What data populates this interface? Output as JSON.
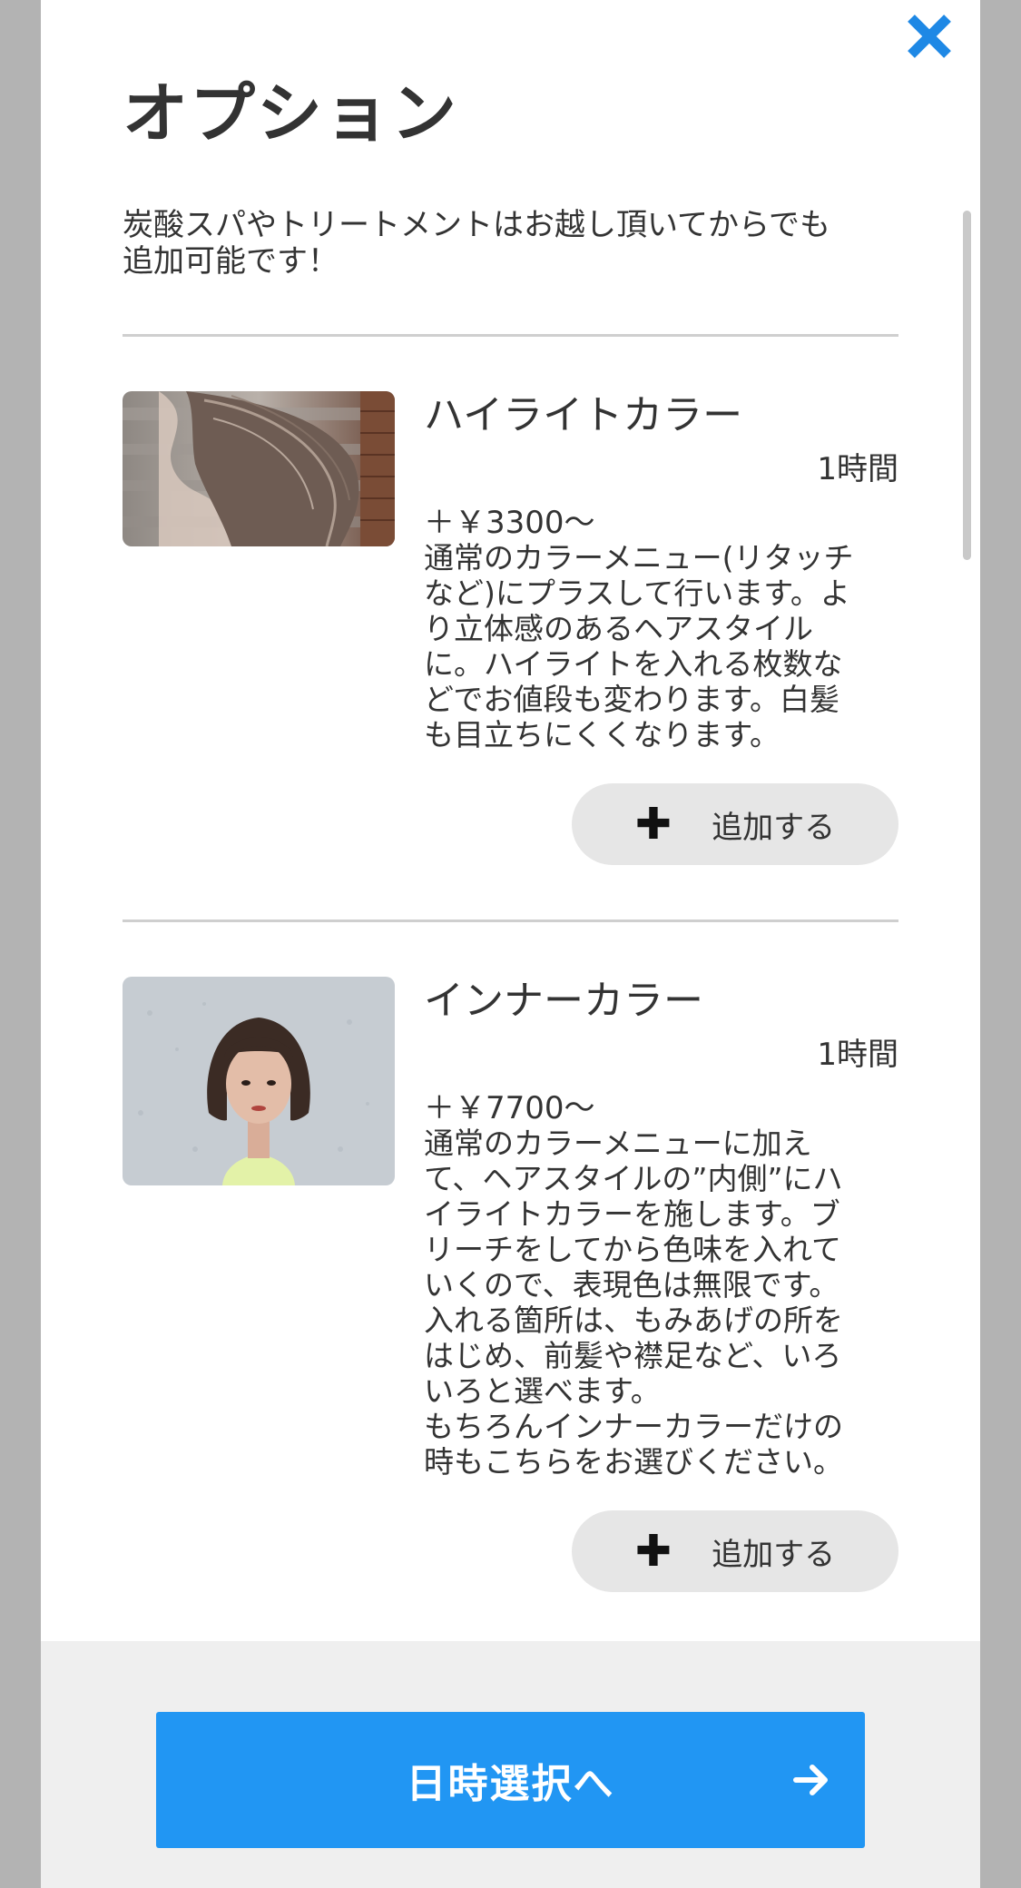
{
  "modal": {
    "title": "オプション",
    "intro": "炭酸スパやトリートメントはお越し頂いてからでも\n追加可能です！",
    "close_icon": "close-icon"
  },
  "options": [
    {
      "name": "ハイライトカラー",
      "duration": "1時間",
      "price": "＋￥3300〜",
      "description": "通常のカラーメニュー(リタッチ\nなど)にプラスして行います。よ\nり立体感のあるヘアスタイル\nに。ハイライトを入れる枚数な\nどでお値段も変わります。白髪\nも目立ちにくくなります。",
      "add_label": "追加する",
      "image": "hair-highlight-photo"
    },
    {
      "name": "インナーカラー",
      "duration": "1時間",
      "price": "＋￥7700〜",
      "description": "通常のカラーメニューに加え\nて、ヘアスタイルの”内側”にハ\nイライトカラーを施します。ブ\nリーチをしてから色味を入れて\nいくので、表現色は無限です。\n入れる箇所は、もみあげの所を\nはじめ、前髪や襟足など、いろ\nいろと選べます。\nもちろんインナーカラーだけの\n時もこちらをお選びください。",
      "add_label": "追加する",
      "image": "inner-color-portrait-photo"
    }
  ],
  "footer": {
    "next_label": "日時選択へ",
    "next_icon": "arrow-right-icon"
  },
  "colors": {
    "accent": "#2196f3",
    "close": "#1e88e5",
    "button_bg": "#e6e6e6"
  }
}
